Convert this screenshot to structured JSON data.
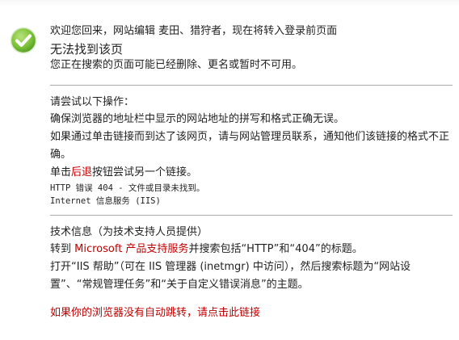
{
  "header": {
    "welcome": "欢迎您回来，网站编辑 麦田、猎狩者，现在将转入登录前页面",
    "title": "无法找到该页",
    "subtitle": "您正在搜索的页面可能已经删除、更名或暂时不可用。"
  },
  "suggestions": {
    "heading": "请尝试以下操作：",
    "item1": "确保浏览器的地址栏中显示的网站地址的拼写和格式正确无误。",
    "item2": "如果通过单击链接而到达了该网页，请与网站管理员联系，通知他们该链接的格式不正确。",
    "item3_prefix": "单击",
    "item3_link": "后退",
    "item3_suffix": "按钮尝试另一个链接。",
    "error_code": "HTTP 错误 404 - 文件或目录未找到。",
    "server": "Internet 信息服务 (IIS)"
  },
  "tech": {
    "heading": "技术信息（为技术支持人员提供）",
    "line1_prefix": "转到 ",
    "line1_link": "Microsoft 产品支持服务",
    "line1_suffix": "并搜索包括“HTTP”和“404”的标题。",
    "line2": "打开“IIS 帮助”（可在 IIS 管理器 (inetmgr) 中访问），然后搜索标题为“网站设置”、“常规管理任务”和“关于自定义错误消息”的主题。"
  },
  "redirect_link": "如果你的浏览器没有自动跳转，请点击此链接",
  "colors": {
    "check": "#7dc23a",
    "link_red": "#c00000",
    "divider": "#a9a9a9"
  },
  "icons": {
    "status": "checkmark-circle-icon"
  }
}
